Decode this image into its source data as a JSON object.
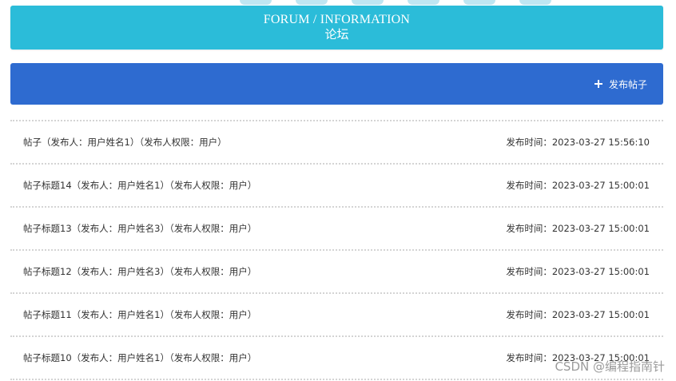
{
  "header": {
    "title_en": "FORUM / INFORMATION",
    "title_cn": "论坛"
  },
  "toolbar": {
    "publish_label": "发布帖子"
  },
  "posts": [
    {
      "title": "帖子（发布人：用户姓名1）（发布人权限：用户）",
      "time": "发布时间：2023-03-27 15:56:10"
    },
    {
      "title": "帖子标题14（发布人：用户姓名1）（发布人权限：用户）",
      "time": "发布时间：2023-03-27 15:00:01"
    },
    {
      "title": "帖子标题13（发布人：用户姓名3）（发布人权限：用户）",
      "time": "发布时间：2023-03-27 15:00:01"
    },
    {
      "title": "帖子标题12（发布人：用户姓名3）（发布人权限：用户）",
      "time": "发布时间：2023-03-27 15:00:01"
    },
    {
      "title": "帖子标题11（发布人：用户姓名1）（发布人权限：用户）",
      "time": "发布时间：2023-03-27 15:00:01"
    },
    {
      "title": "帖子标题10（发布人：用户姓名1）（发布人权限：用户）",
      "time": "发布时间：2023-03-27 15:00:01"
    }
  ],
  "watermark": "CSDN @编程指南针",
  "colors": {
    "header_bg": "#2bbcd9",
    "action_bar_bg": "#2e6bd0"
  }
}
